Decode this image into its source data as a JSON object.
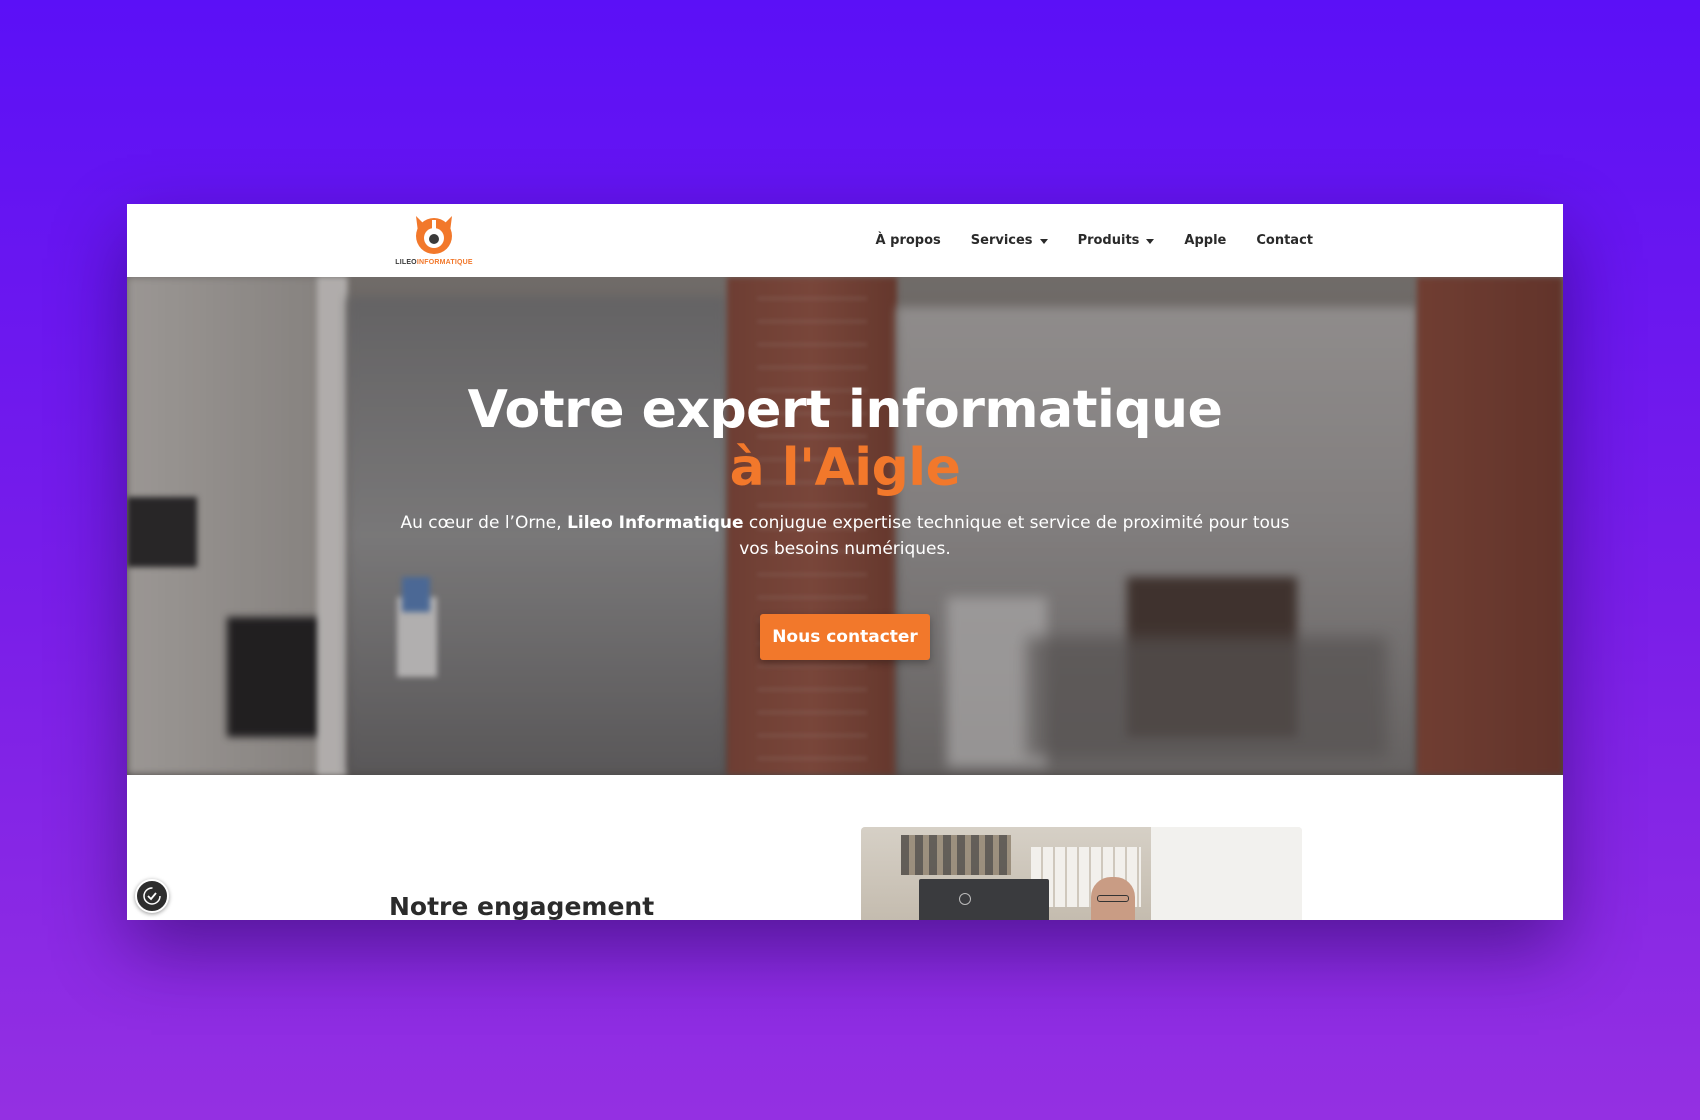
{
  "header": {
    "logo": {
      "text_part1": "LILEO",
      "text_part2": "INFORMATIQUE",
      "icon": "fox-logo-icon"
    },
    "nav": [
      {
        "label": "À propos",
        "has_dropdown": false
      },
      {
        "label": "Services",
        "has_dropdown": true
      },
      {
        "label": "Produits",
        "has_dropdown": true
      },
      {
        "label": "Apple",
        "has_dropdown": false
      },
      {
        "label": "Contact",
        "has_dropdown": false
      }
    ]
  },
  "hero": {
    "title_line1": "Votre expert informatique",
    "title_line2": "à l'Aigle",
    "subtitle_before": "Au cœur de l’Orne, ",
    "subtitle_brand": "Lileo Informatique",
    "subtitle_after": " conjugue expertise technique et service de proximité pour tous vos besoins numériques.",
    "cta_label": "Nous contacter"
  },
  "section": {
    "title": "Notre engagement"
  },
  "accessibility": {
    "icon": "accessibility-icon"
  },
  "colors": {
    "accent": "#f2782b",
    "background_top": "#5b10f7",
    "background_bottom": "#9430e2",
    "text_dark": "#2a2a2a"
  }
}
